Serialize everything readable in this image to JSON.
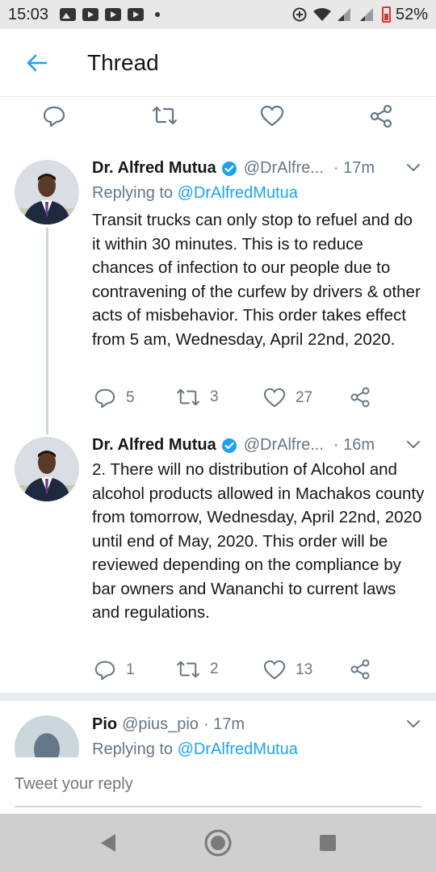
{
  "status": {
    "time": "15:03",
    "battery": "52%"
  },
  "header": {
    "title": "Thread"
  },
  "tweets": [
    {
      "name": "Dr. Alfred Mutua",
      "handle": "@DrAlfre...",
      "time": "· 17m",
      "replying_prefix": "Replying to ",
      "replying_to": "@DrAlfredMutua",
      "text": "Transit trucks can only stop to refuel and do it within 30 minutes. This is to reduce chances of infection to our people due to contravening of the curfew by drivers & other acts of misbehavior. This order takes effect from 5 am, Wednesday, April 22nd, 2020.",
      "replies": "5",
      "retweets": "3",
      "likes": "27"
    },
    {
      "name": "Dr. Alfred Mutua",
      "handle": "@DrAlfre...",
      "time": "· 16m",
      "text": "2. There will no distribution of Alcohol and alcohol products allowed in Machakos county from tomorrow, Wednesday, April 22nd, 2020 until end of May, 2020. This order will be reviewed depending on the compliance by bar owners and Wananchi to current laws and regulations.",
      "replies": "1",
      "retweets": "2",
      "likes": "13"
    },
    {
      "name": "Pio",
      "handle": "@pius_pio",
      "time": "· 17m",
      "replying_prefix": "Replying to ",
      "replying_to": "@DrAlfredMutua"
    }
  ],
  "composer": {
    "placeholder": "Tweet your reply"
  },
  "colors": {
    "accent": "#1da1f2",
    "muted": "#657786"
  }
}
